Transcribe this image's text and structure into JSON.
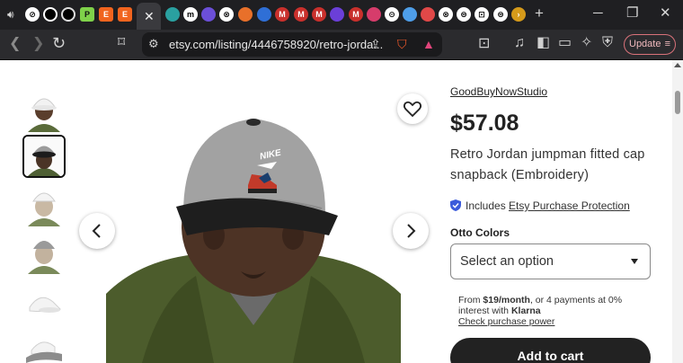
{
  "browser": {
    "url": "etsy.com/listing/4446758920/retro-jorda...",
    "update_label": "Update",
    "tab_letters": [
      "E",
      "E"
    ]
  },
  "listing": {
    "shop_name": "GoodBuyNowStudio",
    "price": "$57.08",
    "title_line1": "Retro Jordan jumpman fitted cap",
    "title_line2": "snapback (Embroidery)",
    "protection_prefix": "Includes ",
    "protection_link": "Etsy Purchase Protection",
    "variant_label": "Otto Colors",
    "select_placeholder": "Select an option",
    "klarna_from": "From ",
    "klarna_amount": "$19/month",
    "klarna_rest": ", or 4 payments at 0%",
    "klarna_line2_prefix": "interest with ",
    "klarna_brand": "Klarna",
    "klarna_check": "Check purchase power",
    "add_to_cart": "Add to cart",
    "cap_logo": "NIKE"
  },
  "colors": {
    "accent_blue": "#3b5bdb",
    "button_dark": "#222222",
    "chrome_dark": "#1f1f22",
    "update_border": "#d9727a"
  },
  "thumbnails": [
    {
      "name": "white cap front",
      "selected": false
    },
    {
      "name": "grey black cap",
      "selected": true
    },
    {
      "name": "white cap back",
      "selected": false
    },
    {
      "name": "grey cap back",
      "selected": false
    },
    {
      "name": "white cap side",
      "selected": false
    },
    {
      "name": "white cap flat",
      "selected": false
    }
  ]
}
